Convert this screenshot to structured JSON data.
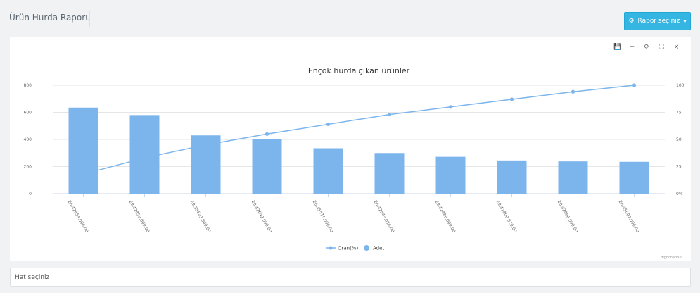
{
  "header": {
    "title": "Ürün Hurda Raporu",
    "report_button": "Rapor seçiniz"
  },
  "toolbar": {
    "save_icon": "💾",
    "minimize_icon": "−",
    "refresh_icon": "⟳",
    "fullscreen_icon": "⛶",
    "close_icon": "×"
  },
  "line_select": {
    "placeholder": "Hat seçiniz"
  },
  "chart_data": {
    "type": "bar",
    "title": "Ençok hurda çıkan ürünler",
    "credits": "Highcharts.c",
    "categories": [
      "20.42859.000.00",
      "20.42853.000.00",
      "20.35623.000.00",
      "20.42642.000.00",
      "20.35575.000.00",
      "20.42545.010.00",
      "20.42486.000.00",
      "20.41800.020.00",
      "20.42886.000.00",
      "20.45002.000.00"
    ],
    "y_left": {
      "ticks": [
        "0",
        "200",
        "400",
        "600",
        "800"
      ],
      "ylim": [
        0,
        800
      ]
    },
    "y_right": {
      "ticks": [
        "0%",
        "25",
        "50",
        "75",
        "100"
      ],
      "ylim": [
        0,
        100
      ]
    },
    "series": [
      {
        "name": "Adet",
        "type": "column",
        "color": "#7cb5ec",
        "values": [
          635,
          580,
          430,
          405,
          335,
          300,
          272,
          245,
          238,
          235
        ]
      },
      {
        "name": "Oran(%)",
        "type": "line",
        "color": "#7cb5ec",
        "values": [
          18,
          33,
          45,
          55,
          64,
          73,
          80,
          87,
          94,
          100
        ]
      }
    ],
    "legend_position": "bottom-center"
  }
}
